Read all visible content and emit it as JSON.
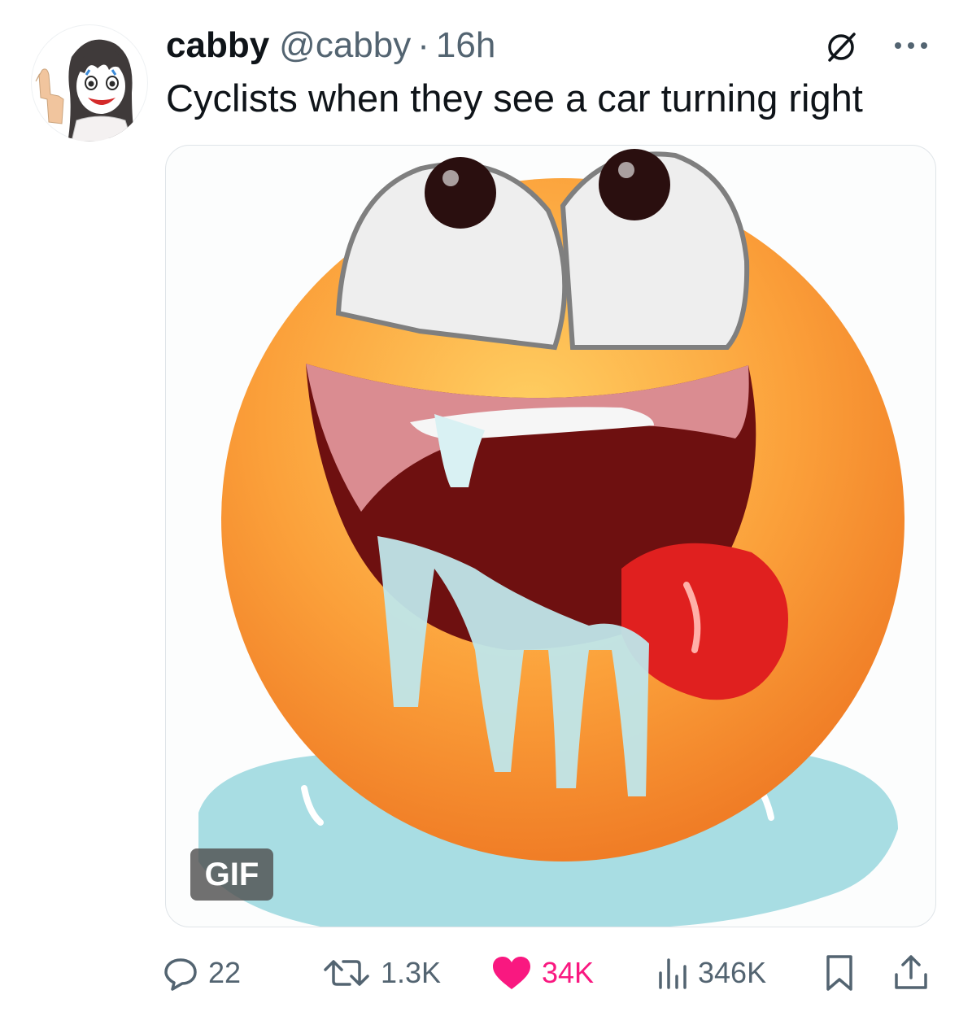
{
  "tweet": {
    "display_name": "cabby",
    "handle": "@cabby",
    "separator": "·",
    "time": "16h",
    "text": "Cyclists when they see a car turning right",
    "avatar_icon": "anime-girl-middle-finger-avatar",
    "media": {
      "type": "gif",
      "badge": "GIF",
      "description_icon": "drooling-emoji"
    }
  },
  "actions": {
    "reply": {
      "icon": "reply-bubble-icon",
      "count": "22"
    },
    "retweet": {
      "icon": "retweet-icon",
      "count": "1.3K"
    },
    "like": {
      "icon": "heart-icon",
      "count": "34K",
      "liked": true
    },
    "views": {
      "icon": "views-bar-icon",
      "count": "346K"
    },
    "bookmark": {
      "icon": "bookmark-icon"
    },
    "share": {
      "icon": "share-icon"
    }
  },
  "colors": {
    "text_primary": "#0f1419",
    "text_secondary": "#536471",
    "like_active": "#f91880",
    "border": "#dfe4e8"
  }
}
